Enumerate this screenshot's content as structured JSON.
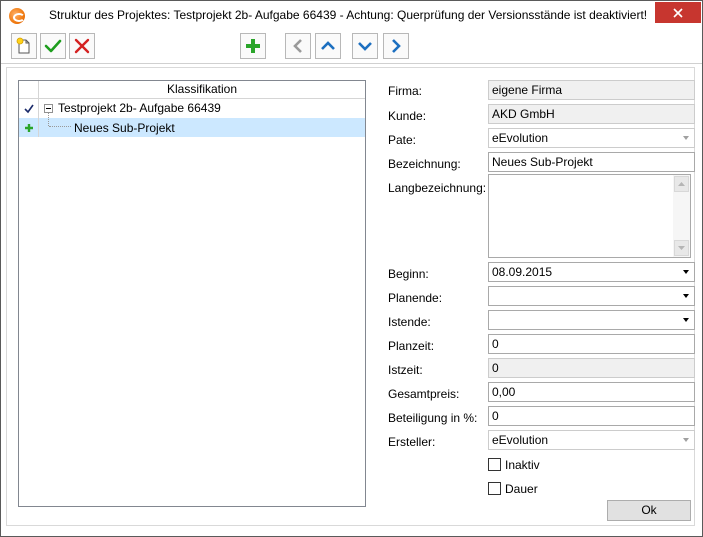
{
  "window": {
    "title": "Struktur des Projektes: Testprojekt 2b- Aufgabe 66439 - Achtung: Querprüfung der Versionsstände ist deaktiviert!",
    "app_icon": "evolution-logo-icon",
    "close_icon": "close-icon"
  },
  "toolbar": {
    "buttons": [
      {
        "icon": "new-document-icon"
      },
      {
        "icon": "checkmark-icon"
      },
      {
        "icon": "red-x-icon"
      },
      {
        "icon": "green-plus-icon"
      },
      {
        "icon": "chevron-left-icon"
      },
      {
        "icon": "chevron-up-icon"
      },
      {
        "icon": "chevron-down-icon"
      },
      {
        "icon": "chevron-right-icon"
      }
    ]
  },
  "tree": {
    "header": "Klassifikation",
    "nodes": [
      {
        "label": "Testprojekt 2b- Aufgabe 66439",
        "marker": "checkmark-icon",
        "expanded": true
      },
      {
        "label": "Neues Sub-Projekt",
        "marker": "green-plus-icon",
        "selected": true
      }
    ]
  },
  "form": {
    "firma": {
      "label": "Firma:",
      "value": "eigene Firma"
    },
    "kunde": {
      "label": "Kunde:",
      "value": "AKD GmbH"
    },
    "pate": {
      "label": "Pate:",
      "value": "eEvolution"
    },
    "bezeichnung": {
      "label": "Bezeichnung:",
      "value": "Neues Sub-Projekt"
    },
    "langbezeichnung": {
      "label": "Langbezeichnung:",
      "value": ""
    },
    "beginn": {
      "label": "Beginn:",
      "value": "08.09.2015"
    },
    "planende": {
      "label": "Planende:",
      "value": ""
    },
    "istende": {
      "label": "Istende:",
      "value": ""
    },
    "planzeit": {
      "label": "Planzeit:",
      "value": "0"
    },
    "istzeit": {
      "label": "Istzeit:",
      "value": "0"
    },
    "gesamtpreis": {
      "label": "Gesamtpreis:",
      "value": "0,00"
    },
    "beteiligung": {
      "label": "Beteiligung in %:",
      "value": "0"
    },
    "ersteller": {
      "label": "Ersteller:",
      "value": "eEvolution"
    },
    "inaktiv": {
      "label": "Inaktiv",
      "checked": false
    },
    "dauer": {
      "label": "Dauer",
      "checked": false
    }
  },
  "ok_label": "Ok",
  "colors": {
    "close_red": "#c7362f",
    "selection": "#cce8ff",
    "green_check": "#1e9e1e",
    "red_x": "#d42121",
    "nav_blue": "#1c6fc0",
    "nav_gray": "#9a9a9a"
  }
}
